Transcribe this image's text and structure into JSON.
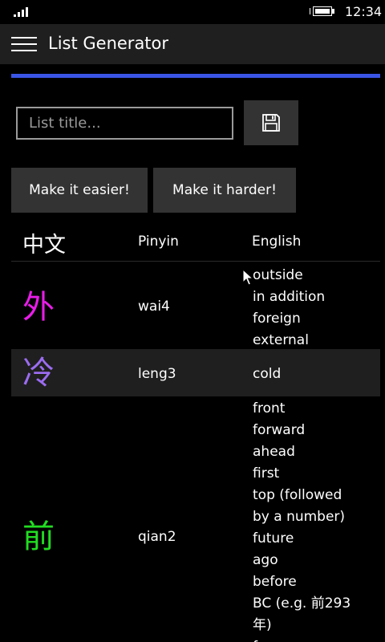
{
  "status_bar": {
    "time": "12:34",
    "signal_icon": "signal-bars-icon",
    "battery_icon": "battery-charging-icon"
  },
  "app_bar": {
    "title": "List Generator",
    "menu_icon": "hamburger-menu-icon"
  },
  "progress": {
    "value_percent": 100,
    "color": "#3a55e6"
  },
  "list_title_input": {
    "placeholder": "List title...",
    "value": ""
  },
  "save_button": {
    "icon": "save-floppy-icon"
  },
  "difficulty": {
    "easier_label": "Make it easier!",
    "harder_label": "Make it harder!"
  },
  "table": {
    "headers": {
      "hanzi": "中文",
      "pinyin": "Pinyin",
      "english": "English"
    },
    "rows": [
      {
        "hanzi": "外",
        "pinyin": "wai4",
        "tone_color": "#e81de8",
        "english": [
          "outside",
          "in addition",
          "foreign",
          "external"
        ]
      },
      {
        "hanzi": "冷",
        "pinyin": "leng3",
        "tone_color": "#9b6cf0",
        "english": [
          "cold"
        ]
      },
      {
        "hanzi": "前",
        "pinyin": "qian2",
        "tone_color": "#22dd22",
        "english": [
          "front",
          "forward",
          "ahead",
          "first",
          "top (followed",
          "by a number)",
          "future",
          "ago",
          "before",
          "BC (e.g. 前293",
          "年)",
          "f..."
        ]
      }
    ]
  },
  "colors": {
    "background": "#000000",
    "app_bar": "#1f1f1f",
    "button": "#333333",
    "accent": "#3a55e6"
  }
}
